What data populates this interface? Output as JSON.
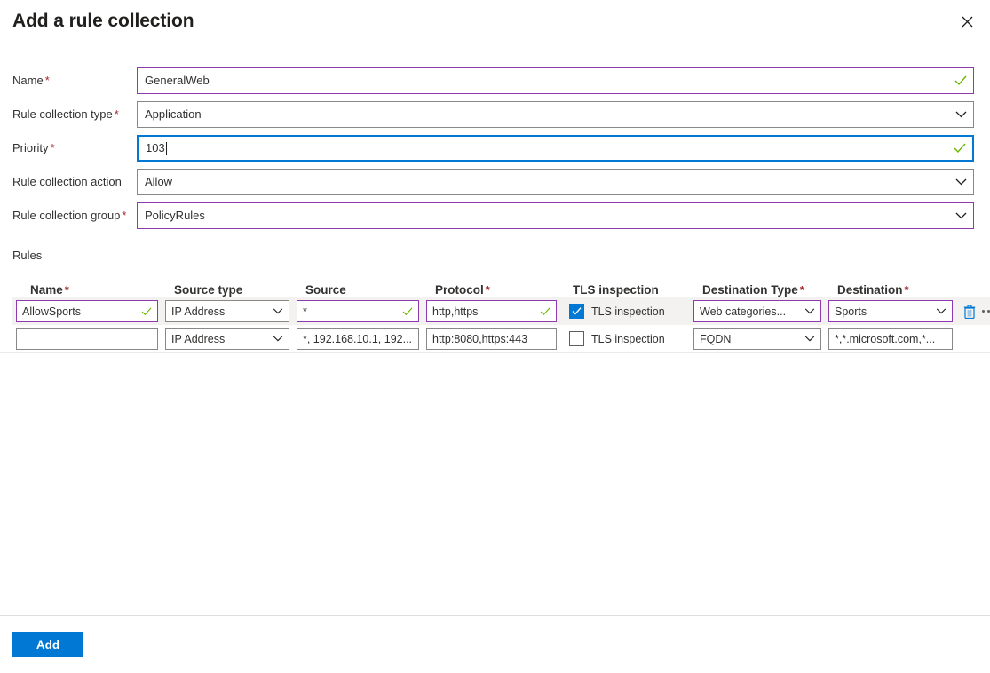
{
  "header": {
    "title": "Add a rule collection",
    "close_label": "Close"
  },
  "form": {
    "fields": [
      {
        "label": "Name",
        "required": true,
        "value": "GeneralWeb",
        "type": "text",
        "state": "valid",
        "border": "purple"
      },
      {
        "label": "Rule collection type",
        "required": true,
        "value": "Application",
        "type": "select",
        "state": "normal",
        "border": "gray"
      },
      {
        "label": "Priority",
        "required": true,
        "value": "103",
        "type": "text",
        "state": "valid",
        "border": "blue-focus"
      },
      {
        "label": "Rule collection action",
        "required": false,
        "value": "Allow",
        "type": "select",
        "state": "normal",
        "border": "gray"
      },
      {
        "label": "Rule collection group",
        "required": true,
        "value": "PolicyRules",
        "type": "select",
        "state": "normal",
        "border": "purple"
      }
    ]
  },
  "rules": {
    "section_label": "Rules",
    "columns": [
      {
        "label": "Name",
        "required": true
      },
      {
        "label": "Source type",
        "required": false
      },
      {
        "label": "Source",
        "required": false
      },
      {
        "label": "Protocol",
        "required": true
      },
      {
        "label": "TLS inspection",
        "required": false
      },
      {
        "label": "Destination Type",
        "required": true
      },
      {
        "label": "Destination",
        "required": true
      }
    ],
    "rows": [
      {
        "selected": true,
        "name": {
          "value": "AllowSports",
          "placeholder": "",
          "valid": true,
          "border": "purple"
        },
        "source_type": {
          "value": "IP Address",
          "border": "gray"
        },
        "source": {
          "value": "*",
          "placeholder": "",
          "valid": true,
          "border": "purple"
        },
        "protocol": {
          "value": "http,https",
          "placeholder": "",
          "valid": true,
          "border": "purple"
        },
        "tls": {
          "checked": true,
          "label": "TLS inspection"
        },
        "destination_type": {
          "value": "Web categories...",
          "border": "purple"
        },
        "destination": {
          "value": "Sports",
          "border": "purple"
        },
        "actions": {
          "delete_label": "Delete",
          "more_label": "More options"
        }
      },
      {
        "selected": false,
        "name": {
          "value": "",
          "placeholder": "",
          "valid": false,
          "border": "gray"
        },
        "source_type": {
          "value": "IP Address",
          "border": "gray"
        },
        "source": {
          "value": "",
          "placeholder": "*, 192.168.10.1, 192...",
          "valid": false,
          "border": "gray"
        },
        "protocol": {
          "value": "",
          "placeholder": "http:8080,https:443",
          "valid": false,
          "border": "gray"
        },
        "tls": {
          "checked": false,
          "label": "TLS inspection"
        },
        "destination_type": {
          "value": "FQDN",
          "border": "gray"
        },
        "destination": {
          "value": "",
          "placeholder": "*,*.microsoft.com,*...",
          "border": "gray"
        }
      }
    ]
  },
  "footer": {
    "add_label": "Add"
  },
  "colors": {
    "accent_blue": "#0078d4",
    "valid_green": "#498205",
    "required_red": "#a4262c",
    "purple_border": "#903ab0",
    "gray_border": "#8a8886",
    "row_selected_bg": "#f3f2f1"
  }
}
